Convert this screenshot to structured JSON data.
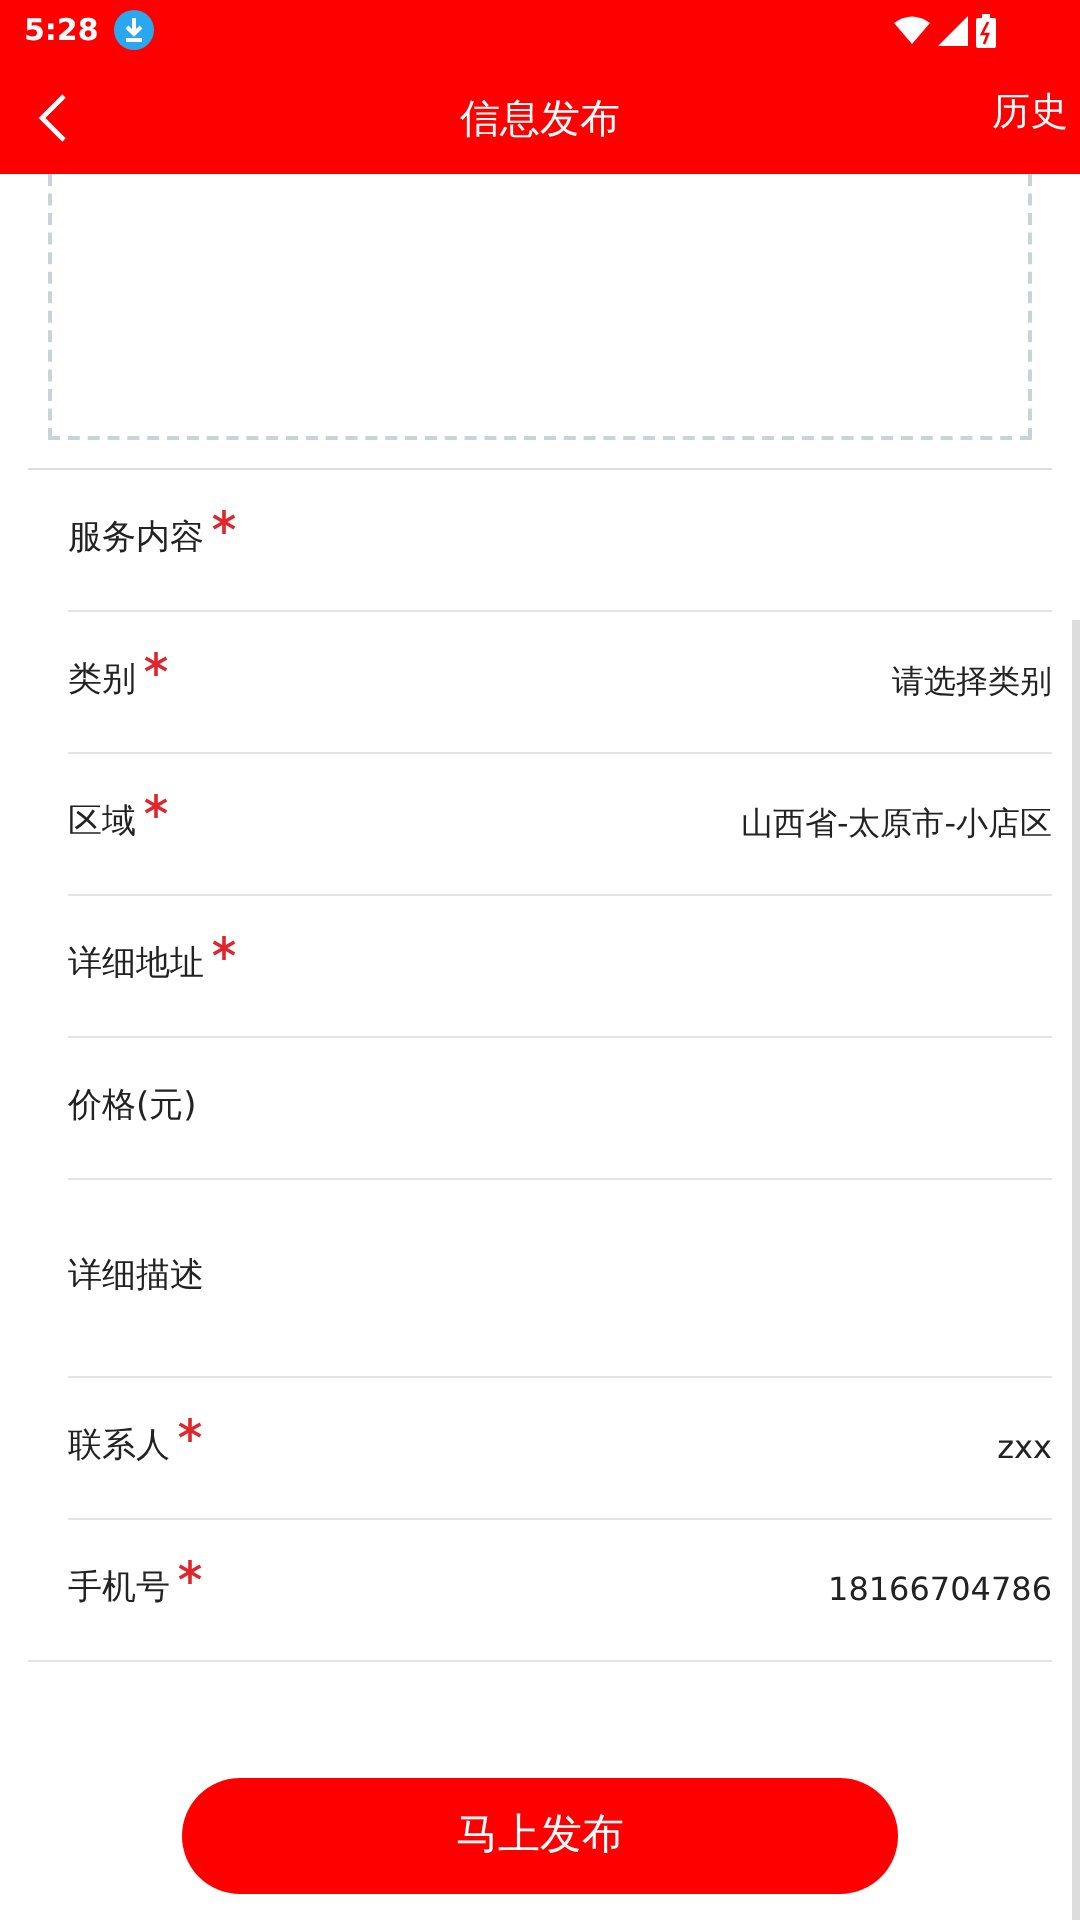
{
  "status_bar": {
    "time": "5:28"
  },
  "app_bar": {
    "title": "信息发布",
    "action": "历史"
  },
  "fields": [
    {
      "kind": "line",
      "label": "服务内容",
      "required": true
    },
    {
      "kind": "line",
      "label": "类别",
      "required": true,
      "value": "请选择类别"
    },
    {
      "kind": "line",
      "label": "区域",
      "required": true,
      "value": "山西省-太原市-小店区"
    },
    {
      "kind": "line",
      "label": "详细地址",
      "required": true
    },
    {
      "kind": "line",
      "label": "价格(元)",
      "required": false
    },
    {
      "kind": "area",
      "label": "详细描述",
      "required": false
    },
    {
      "kind": "line",
      "label": "联系人",
      "required": true,
      "value": "zxx"
    },
    {
      "kind": "line",
      "label": "手机号",
      "required": true,
      "value": "18166704786"
    }
  ],
  "submit_button": "马上发布"
}
